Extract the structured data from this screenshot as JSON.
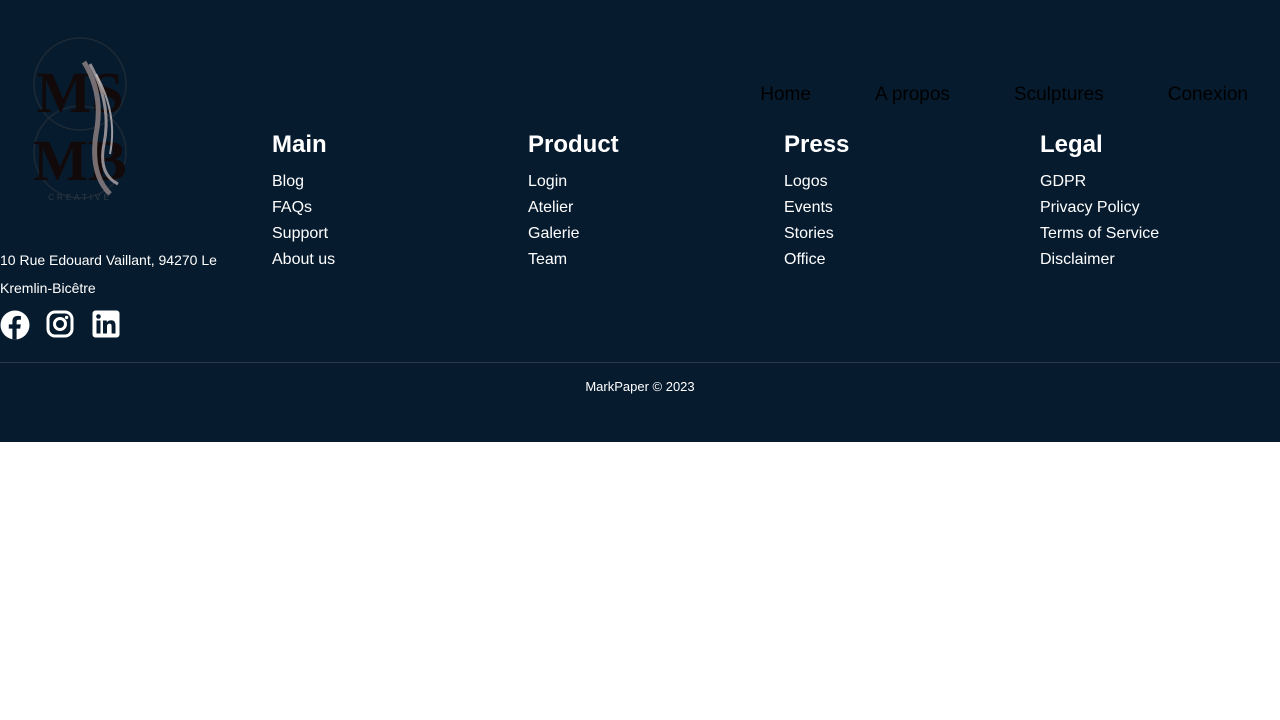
{
  "nav": {
    "items": [
      {
        "label": "Home"
      },
      {
        "label": "A propos"
      },
      {
        "label": "Sculptures"
      },
      {
        "label": "Conexion"
      }
    ]
  },
  "logo": {
    "letters_top": "MS",
    "letters_bottom": "MB",
    "tagline": "CREATIVE"
  },
  "footer": {
    "columns": [
      {
        "title": "Main",
        "links": [
          "Blog",
          "FAQs",
          "Support",
          "About us"
        ]
      },
      {
        "title": "Product",
        "links": [
          "Login",
          "Atelier",
          "Galerie",
          "Team"
        ]
      },
      {
        "title": "Press",
        "links": [
          "Logos",
          "Events",
          "Stories",
          "Office"
        ]
      },
      {
        "title": "Legal",
        "links": [
          "GDPR",
          "Privacy Policy",
          "Terms of Service",
          "Disclaimer"
        ]
      }
    ],
    "address": "10 Rue Edouard Vaillant, 94270 Le Kremlin-Bicêtre",
    "socials": [
      {
        "icon": "facebook-icon"
      },
      {
        "icon": "instagram-icon"
      },
      {
        "icon": "linkedin-icon"
      }
    ],
    "copyright": "MarkPaper © 2023"
  },
  "colors": {
    "background": "#071b2e",
    "text": "#ffffff",
    "nav_text": "#000000"
  }
}
